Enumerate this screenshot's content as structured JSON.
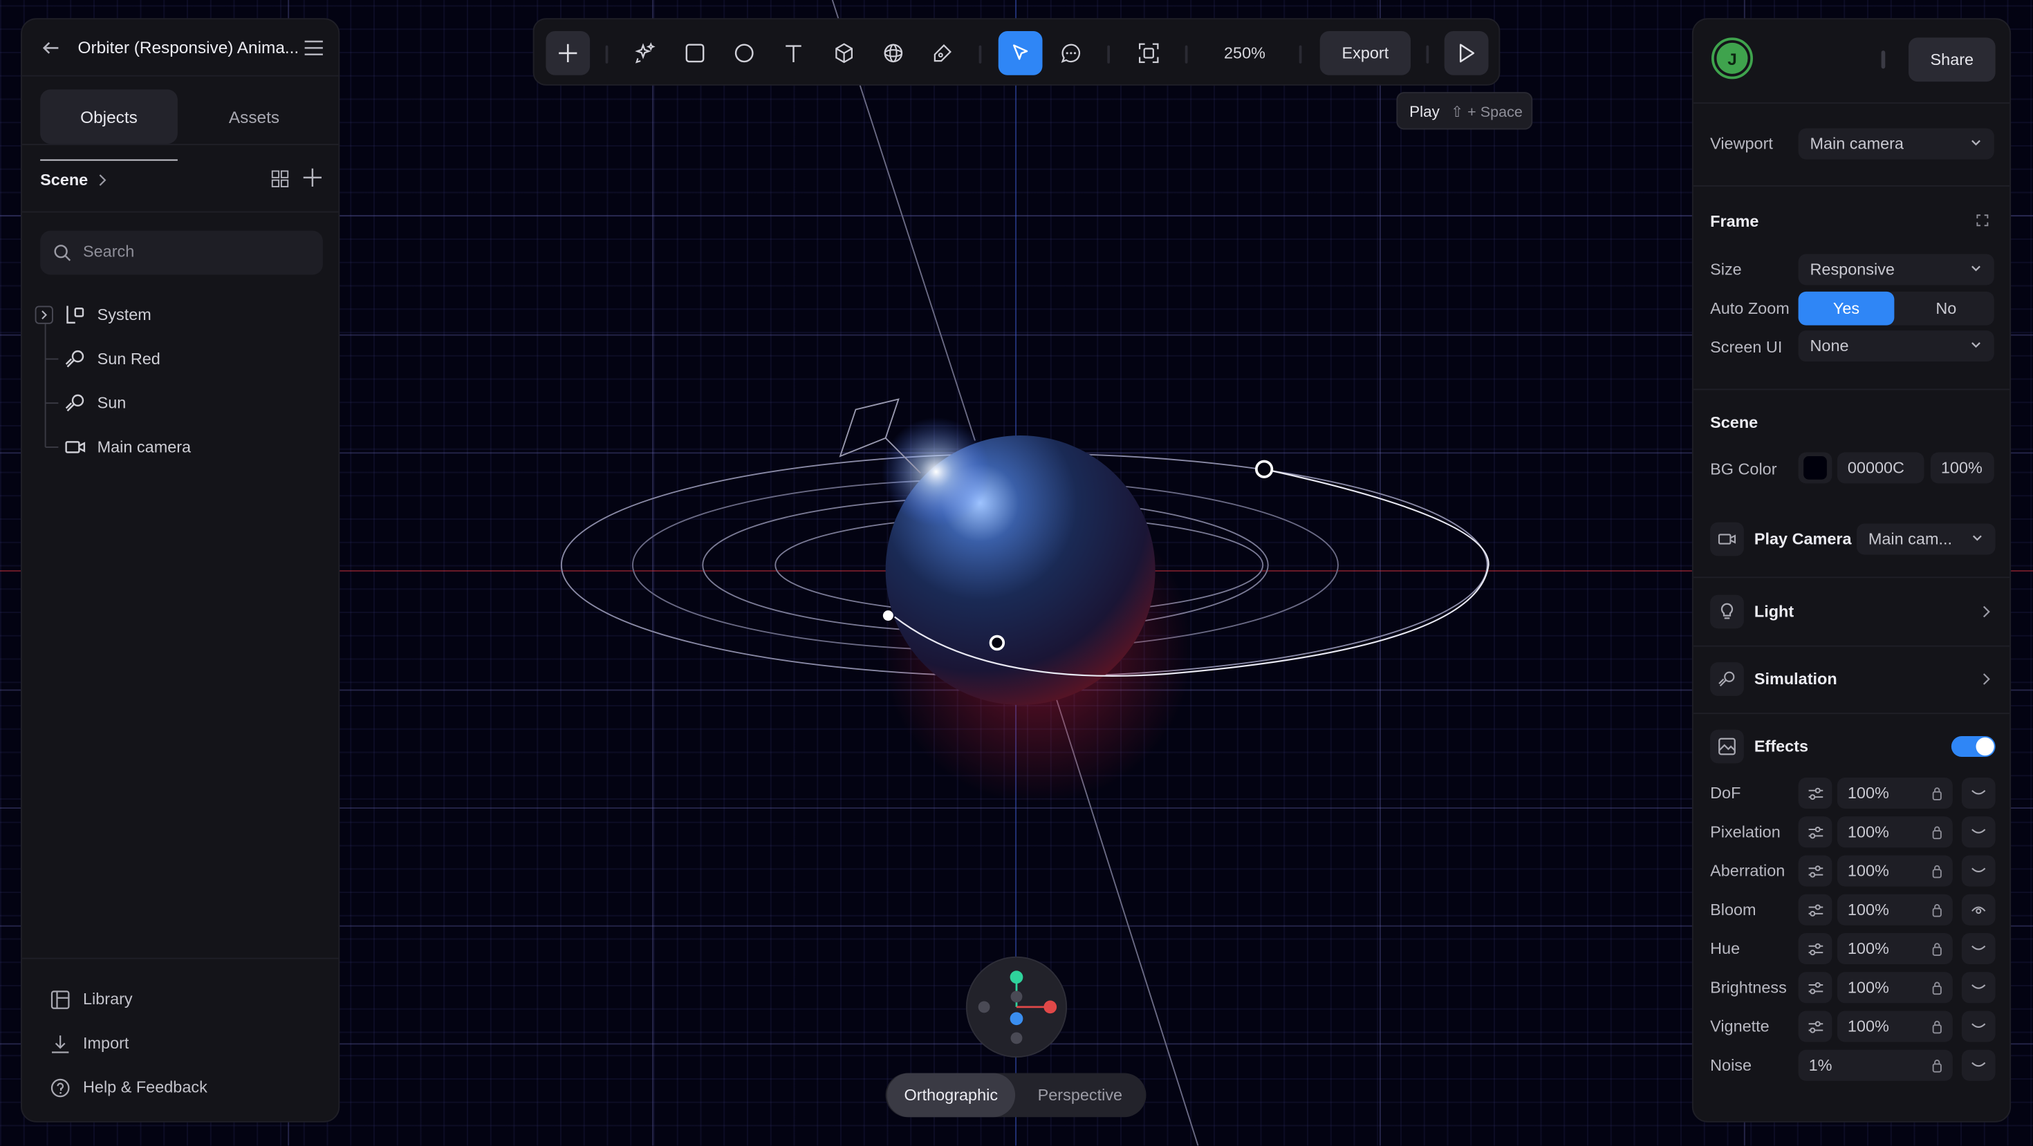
{
  "app": {
    "title": "Orbiter (Responsive) Anima..."
  },
  "left_panel": {
    "tabs": [
      {
        "label": "Objects",
        "active": true
      },
      {
        "label": "Assets",
        "active": false
      }
    ],
    "scene_label": "Scene",
    "search_placeholder": "Search",
    "tree": [
      {
        "label": "System",
        "icon": "group-icon",
        "expandable": true
      },
      {
        "label": "Sun Red",
        "icon": "light-icon"
      },
      {
        "label": "Sun",
        "icon": "light-icon"
      },
      {
        "label": "Main camera",
        "icon": "camera-icon"
      }
    ],
    "bottom": [
      {
        "label": "Library",
        "icon": "library-icon"
      },
      {
        "label": "Import",
        "icon": "import-icon"
      },
      {
        "label": "Help & Feedback",
        "icon": "help-icon"
      }
    ]
  },
  "toolbar": {
    "tools": [
      "add-icon",
      "magic-icon",
      "rectangle-icon",
      "ellipse-icon",
      "text-icon",
      "cube-icon",
      "sphere-icon",
      "pen-icon",
      "select-icon",
      "comment-icon",
      "frame-icon"
    ],
    "active_tool": "select-icon",
    "zoom": "250%",
    "export_label": "Export",
    "play_icon": "play-icon"
  },
  "tooltip": {
    "label": "Play",
    "shortcut": "⇧ + Space"
  },
  "view_toggle": {
    "options": [
      "Orthographic",
      "Perspective"
    ],
    "active": "Orthographic"
  },
  "right_panel": {
    "avatar_letter": "J",
    "share_label": "Share",
    "viewport_label": "Viewport",
    "viewport_value": "Main camera",
    "frame": {
      "title": "Frame",
      "size_label": "Size",
      "size_value": "Responsive",
      "autozoom_label": "Auto Zoom",
      "autozoom_yes": "Yes",
      "autozoom_no": "No",
      "autozoom_selected": "Yes",
      "screenui_label": "Screen UI",
      "screenui_value": "None"
    },
    "scene": {
      "title": "Scene",
      "bg_label": "BG Color",
      "bg_hex": "00000C",
      "bg_opacity": "100%",
      "bg_swatch": "#00000c",
      "play_camera_label": "Play Camera",
      "play_camera_value": "Main cam..."
    },
    "sections": [
      {
        "label": "Light",
        "icon": "bulb-icon"
      },
      {
        "label": "Simulation",
        "icon": "simulation-icon"
      }
    ],
    "effects": {
      "label": "Effects",
      "enabled": true,
      "rows": [
        {
          "label": "DoF",
          "value": "100%"
        },
        {
          "label": "Pixelation",
          "value": "100%"
        },
        {
          "label": "Aberration",
          "value": "100%"
        },
        {
          "label": "Bloom",
          "value": "100%"
        },
        {
          "label": "Hue",
          "value": "100%"
        },
        {
          "label": "Brightness",
          "value": "100%"
        },
        {
          "label": "Vignette",
          "value": "100%"
        },
        {
          "label": "Noise",
          "value": "1%"
        }
      ]
    }
  },
  "colors": {
    "accent": "#2f86f6",
    "avatar": "#3fa34d",
    "x_axis": "#e04848",
    "y_axis": "#2fd39c",
    "z_axis": "#3a8ef0"
  }
}
